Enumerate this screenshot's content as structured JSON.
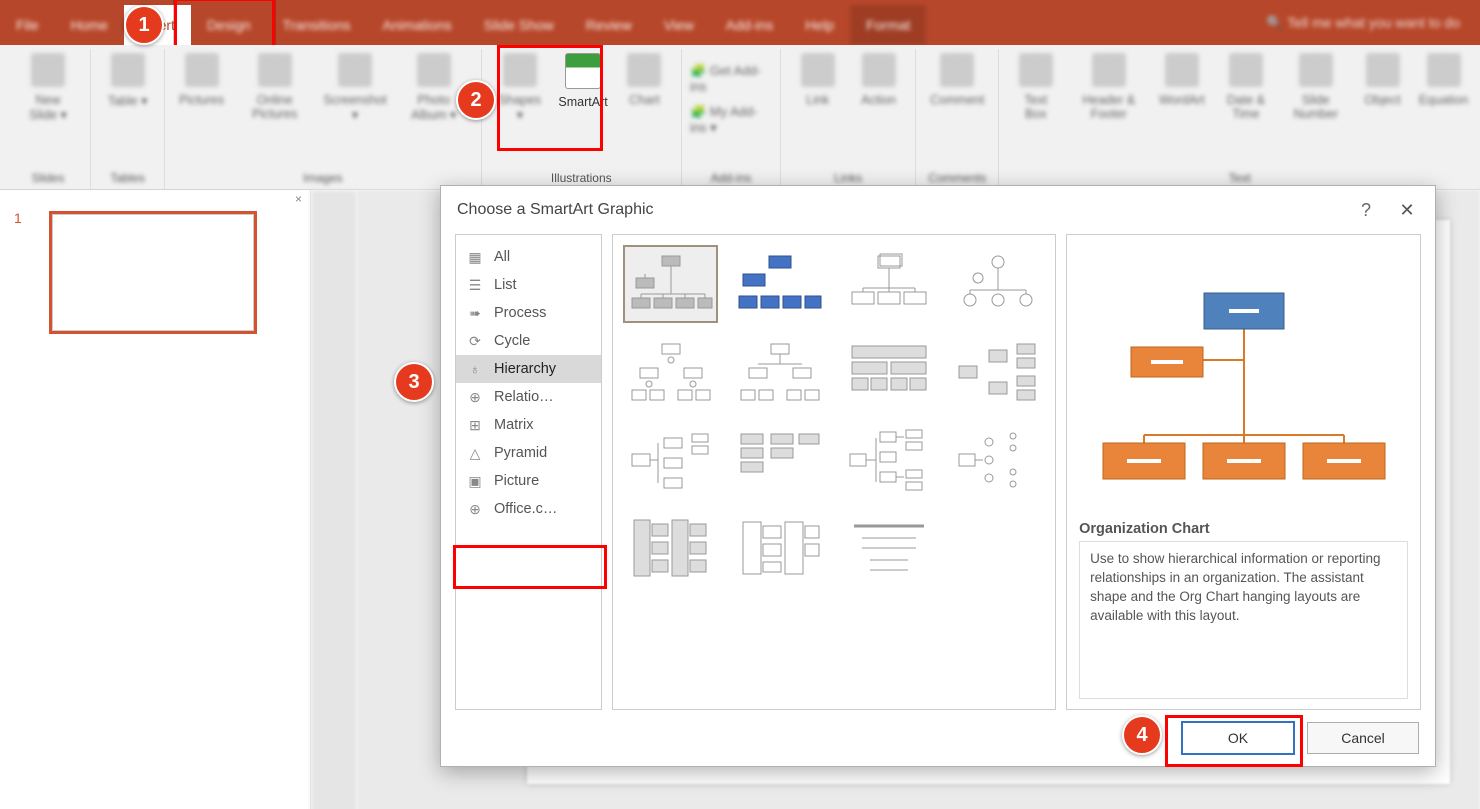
{
  "ribbon": {
    "tabs": [
      "File",
      "Home",
      "Insert",
      "Design",
      "Transitions",
      "Animations",
      "Slide Show",
      "Review",
      "View",
      "Add-ins",
      "Help",
      "Format"
    ],
    "active_tab": "Insert",
    "tell_me": "Tell me what you want to do",
    "groups": {
      "slides": {
        "label": "Slides",
        "btns": [
          "New Slide ▾"
        ]
      },
      "tables": {
        "label": "Tables",
        "btns": [
          "Table ▾"
        ]
      },
      "images": {
        "label": "Images",
        "btns": [
          "Pictures",
          "Online Pictures",
          "Screenshot ▾",
          "Photo Album ▾"
        ]
      },
      "illus": {
        "label": "Illustrations",
        "btns": [
          "Shapes ▾",
          "SmartArt",
          "Chart"
        ]
      },
      "addins": {
        "label": "Add-ins",
        "btns": [
          "Get Add-ins",
          "My Add-ins ▾"
        ]
      },
      "links": {
        "label": "Links",
        "btns": [
          "Link",
          "Action"
        ]
      },
      "comments": {
        "label": "Comments",
        "btns": [
          "Comment"
        ]
      },
      "text": {
        "label": "Text",
        "btns": [
          "Text Box",
          "Header & Footer",
          "WordArt",
          "Date & Time",
          "Slide Number",
          "Object",
          "Equation"
        ]
      }
    }
  },
  "thumb": {
    "number": "1"
  },
  "dialog": {
    "title": "Choose a SmartArt Graphic",
    "categories": [
      "All",
      "List",
      "Process",
      "Cycle",
      "Hierarchy",
      "Relatio…",
      "Matrix",
      "Pyramid",
      "Picture",
      "Office.c…"
    ],
    "selected_category": "Hierarchy",
    "preview_title": "Organization Chart",
    "preview_desc": "Use to show hierarchical information or reporting relationships in an organization. The assistant shape and the Org Chart hanging layouts are available with this layout.",
    "ok": "OK",
    "cancel": "Cancel"
  },
  "badges": {
    "b1": "1",
    "b2": "2",
    "b3": "3",
    "b4": "4"
  }
}
